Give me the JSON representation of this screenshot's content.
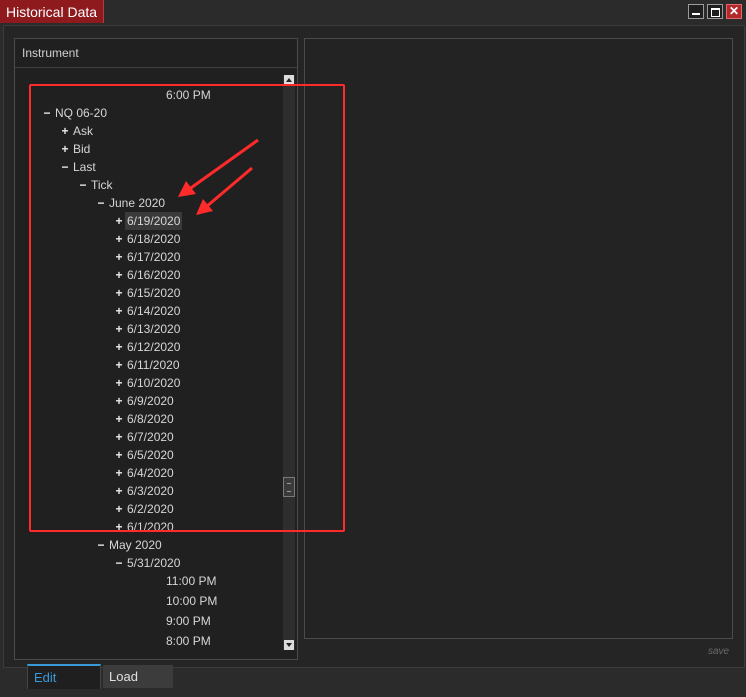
{
  "window": {
    "title": "Historical Data",
    "controls": {
      "close_glyph": "✕"
    }
  },
  "instrument_panel": {
    "header": "Instrument",
    "tree": [
      {
        "label": "6:00 PM",
        "toggle": "",
        "level": 5
      },
      {
        "label": "NQ 06-20",
        "toggle": "−",
        "level": 0
      },
      {
        "label": "Ask",
        "toggle": "+",
        "level": 1
      },
      {
        "label": "Bid",
        "toggle": "+",
        "level": 1
      },
      {
        "label": "Last",
        "toggle": "−",
        "level": 1
      },
      {
        "label": "Tick",
        "toggle": "−",
        "level": 2
      },
      {
        "label": "June 2020",
        "toggle": "−",
        "level": 3
      },
      {
        "label": "6/19/2020",
        "toggle": "+",
        "level": 4,
        "selected": true
      },
      {
        "label": "6/18/2020",
        "toggle": "+",
        "level": 4
      },
      {
        "label": "6/17/2020",
        "toggle": "+",
        "level": 4
      },
      {
        "label": "6/16/2020",
        "toggle": "+",
        "level": 4
      },
      {
        "label": "6/15/2020",
        "toggle": "+",
        "level": 4
      },
      {
        "label": "6/14/2020",
        "toggle": "+",
        "level": 4
      },
      {
        "label": "6/13/2020",
        "toggle": "+",
        "level": 4
      },
      {
        "label": "6/12/2020",
        "toggle": "+",
        "level": 4
      },
      {
        "label": "6/11/2020",
        "toggle": "+",
        "level": 4
      },
      {
        "label": "6/10/2020",
        "toggle": "+",
        "level": 4
      },
      {
        "label": "6/9/2020",
        "toggle": "+",
        "level": 4
      },
      {
        "label": "6/8/2020",
        "toggle": "+",
        "level": 4
      },
      {
        "label": "6/7/2020",
        "toggle": "+",
        "level": 4
      },
      {
        "label": "6/5/2020",
        "toggle": "+",
        "level": 4
      },
      {
        "label": "6/4/2020",
        "toggle": "+",
        "level": 4
      },
      {
        "label": "6/3/2020",
        "toggle": "+",
        "level": 4
      },
      {
        "label": "6/2/2020",
        "toggle": "+",
        "level": 4
      },
      {
        "label": "6/1/2020",
        "toggle": "+",
        "level": 4
      },
      {
        "label": "May 2020",
        "toggle": "−",
        "level": 3
      },
      {
        "label": "5/31/2020",
        "toggle": "−",
        "level": 4
      },
      {
        "label": "11:00 PM",
        "toggle": "",
        "level": 5
      },
      {
        "label": "10:00 PM",
        "toggle": "",
        "level": 5
      },
      {
        "label": "9:00 PM",
        "toggle": "",
        "level": 5
      },
      {
        "label": "8:00 PM",
        "toggle": "",
        "level": 5
      }
    ]
  },
  "footer": {
    "save_label": "save",
    "tabs": [
      "Edit",
      "Load"
    ],
    "active_tab": "Edit"
  },
  "colors": {
    "title_bg": "#8e1a1e",
    "annotation": "#ff2a2a",
    "active_tab": "#3a9ad9"
  }
}
